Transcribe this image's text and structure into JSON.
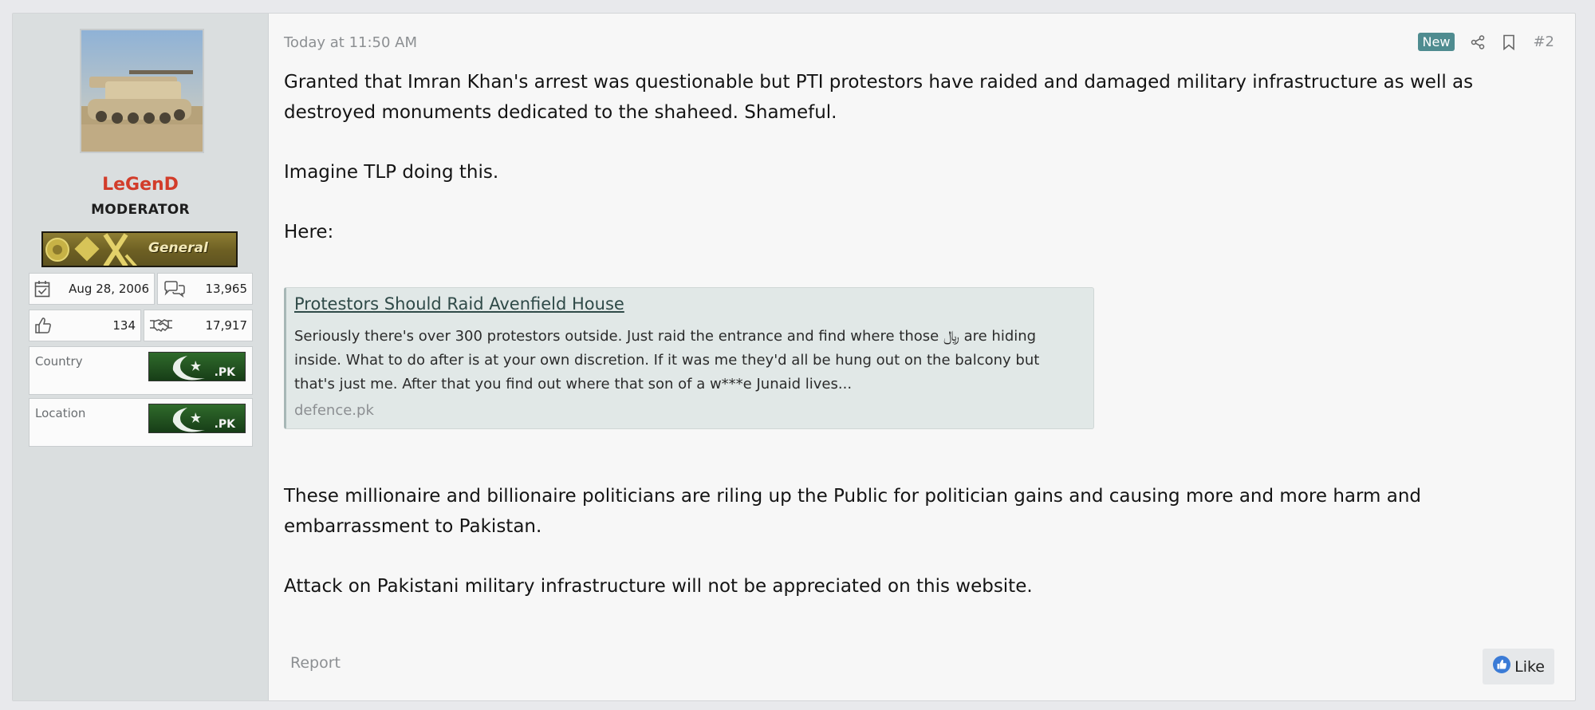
{
  "user": {
    "name": "LeGenD",
    "title": "MODERATOR",
    "rank_label": "General",
    "joined": "Aug 28, 2006",
    "messages": "13,965",
    "reactions": "134",
    "points": "17,917",
    "country_label": "Country",
    "location_label": "Location",
    "flag_text": ".PK"
  },
  "post": {
    "timestamp": "Today at 11:50 AM",
    "new_badge": "New",
    "number": "#2",
    "paragraph1": "Granted that Imran Khan's arrest was questionable but PTI protestors have raided and damaged military infrastructure as well as destroyed monuments dedicated to the shaheed. Shameful.",
    "paragraph2": "Imagine TLP doing this.",
    "paragraph3": "Here:",
    "paragraph4": "These millionaire and billionaire politicians are riling up the Public for politician gains and causing more and more harm and embarrassment to Pakistan.",
    "paragraph5": "Attack on Pakistani military infrastructure will not be appreciated on this website."
  },
  "unfurl": {
    "title": "Protestors Should Raid Avenfield House",
    "description": "Seriously there's over 300 protestors outside. Just raid the entrance and find where those ﷼ are hiding inside. What to do after is at your own discretion. If it was me they'd all be hung out on the balcony but that's just me. After that you find out where that son of a w***e Junaid lives...",
    "domain": "defence.pk"
  },
  "footer": {
    "report_label": "Report",
    "like_label": "Like"
  },
  "colors": {
    "username": "#d23c2a",
    "new_badge": "#4f8c90",
    "like_icon": "#3b7bd6"
  },
  "icons": [
    "calendar-icon",
    "messages-icon",
    "thumbs-up-icon",
    "handshake-icon",
    "share-icon",
    "bookmark-icon",
    "like-icon"
  ]
}
